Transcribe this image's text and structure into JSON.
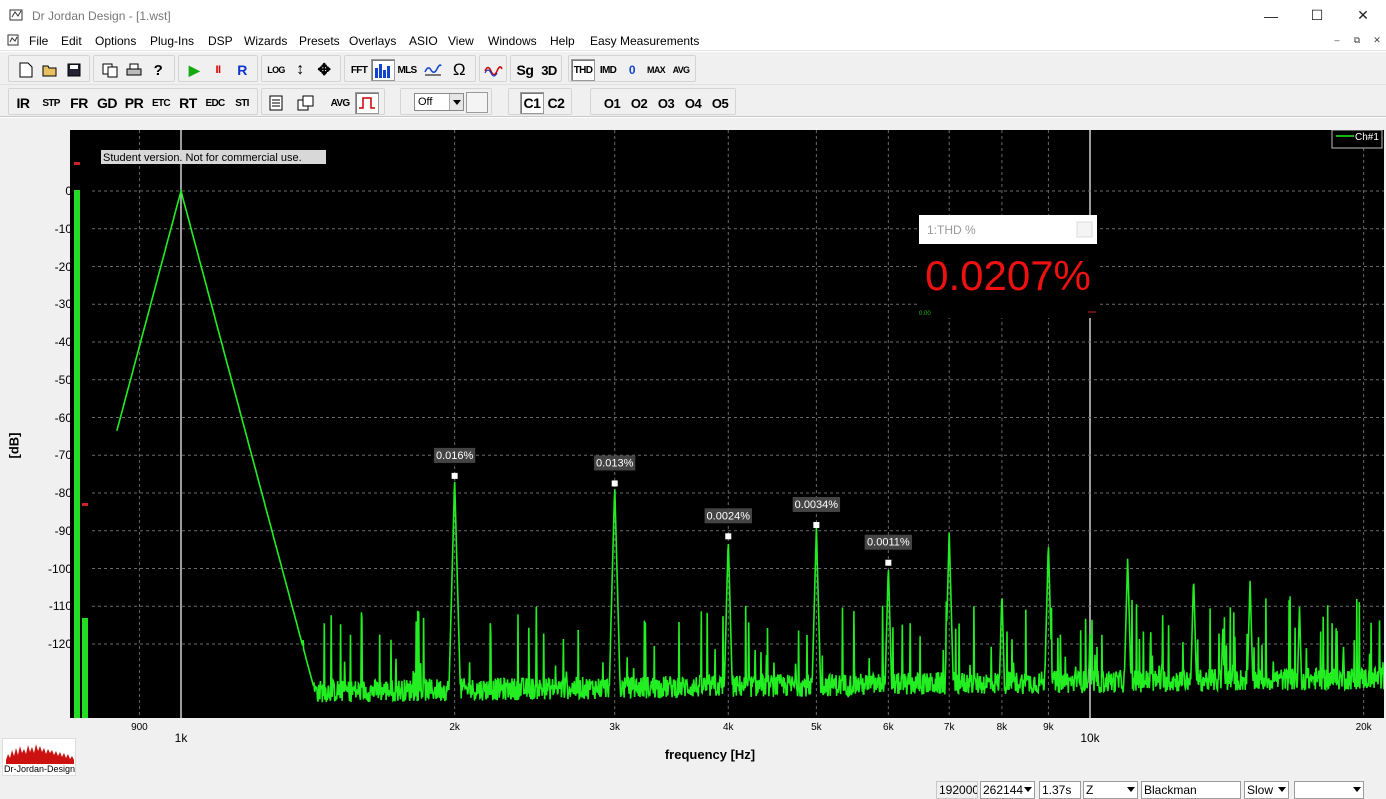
{
  "window": {
    "title": "Dr Jordan Design - [1.wst]",
    "controls": {
      "minimize": "—",
      "maximize": "☐",
      "close": "✕"
    }
  },
  "menu": {
    "items": [
      "File",
      "Edit",
      "Options",
      "Plug-Ins",
      "DSP",
      "Wizards",
      "Presets",
      "Overlays",
      "ASIO",
      "View",
      "Windows",
      "Help",
      "Easy Measurements"
    ],
    "mdi": {
      "minimize": "–",
      "restore": "⧉",
      "close": "✕"
    }
  },
  "toolbar1": {
    "log": "LOG",
    "fft": "FFT",
    "mls": "MLS",
    "omega": "Ω",
    "sg": "Sg",
    "three_d": "3D",
    "thd": "THD",
    "imd": "IMD",
    "zero": "0",
    "max": "MAX",
    "avg": "AVG",
    "play": "▶",
    "pause": "II",
    "record": "R"
  },
  "toolbar2": {
    "modes": [
      "IR",
      "STP",
      "FR",
      "GD",
      "PR",
      "ETC",
      "RT",
      "EDC",
      "STI"
    ],
    "avg": "AVG",
    "select_value": "Off",
    "channels": [
      "C1",
      "C2"
    ],
    "overlays": [
      "O1",
      "O2",
      "O3",
      "O4",
      "O5"
    ]
  },
  "plot": {
    "notice": "Student version. Not for commercial use.",
    "legend": "Ch#1",
    "y_axis_label": "[dB]",
    "x_axis_label": "frequency [Hz]",
    "y_ticks": [
      "0",
      "-10",
      "-20",
      "-30",
      "-40",
      "-50",
      "-60",
      "-70",
      "-80",
      "-90",
      "-100",
      "-110",
      "-120"
    ],
    "x_ticks_small": [
      "900",
      "2k",
      "3k",
      "4k",
      "5k",
      "6k",
      "7k",
      "8k",
      "9k",
      "20k"
    ],
    "x_ticks_big": [
      "1k",
      "10k"
    ],
    "harmonic_labels": [
      "0.016%",
      "0.013%",
      "0.0024%",
      "0.0034%",
      "0.0011%"
    ],
    "colors": {
      "trace": "#22ee22",
      "background": "#000000",
      "grid": "#6a6a6a",
      "thd_value": "#ee1111"
    }
  },
  "chart_data": {
    "type": "line",
    "xlabel": "frequency [Hz]",
    "ylabel": "[dB]",
    "x_scale": "log",
    "xlim": [
      850,
      22000
    ],
    "ylim": [
      -140,
      0
    ],
    "grid": true,
    "legend": "top-right",
    "series": [
      {
        "name": "Ch#1",
        "fundamental": {
          "freq": 1000,
          "level": 0
        },
        "peaks": [
          {
            "freq": 2000,
            "level": -76,
            "label": "0.016%"
          },
          {
            "freq": 3000,
            "level": -78,
            "label": "0.013%"
          },
          {
            "freq": 4000,
            "level": -92,
            "label": "0.0024%"
          },
          {
            "freq": 5000,
            "level": -89,
            "label": "0.0034%"
          },
          {
            "freq": 6000,
            "level": -99,
            "label": "0.0011%"
          },
          {
            "freq": 7000,
            "level": -90
          },
          {
            "freq": 8000,
            "level": -106
          },
          {
            "freq": 9000,
            "level": -93
          },
          {
            "freq": 10000,
            "level": -117
          },
          {
            "freq": 11000,
            "level": -97
          },
          {
            "freq": 12000,
            "level": -123
          },
          {
            "freq": 13000,
            "level": -102
          },
          {
            "freq": 14000,
            "level": -115
          },
          {
            "freq": 15000,
            "level": -103
          },
          {
            "freq": 16000,
            "level": -127
          },
          {
            "freq": 17000,
            "level": -110
          },
          {
            "freq": 19000,
            "level": -120
          },
          {
            "freq": 21000,
            "level": -124
          }
        ],
        "noise_floor": -133
      }
    ]
  },
  "thd_panel": {
    "title": "1:THD %",
    "value": "0.0207%",
    "small_readout": "0.00"
  },
  "meters": {
    "left_level": 1.0,
    "right_level": 0.19
  },
  "logo": {
    "text": "Dr-Jordan-Design"
  },
  "status": {
    "sample_rate": "192000",
    "fft_size": "262144",
    "duration": "1.37s",
    "weighting": "Z",
    "window": "Blackman",
    "speed": "Slow",
    "extra": ""
  }
}
